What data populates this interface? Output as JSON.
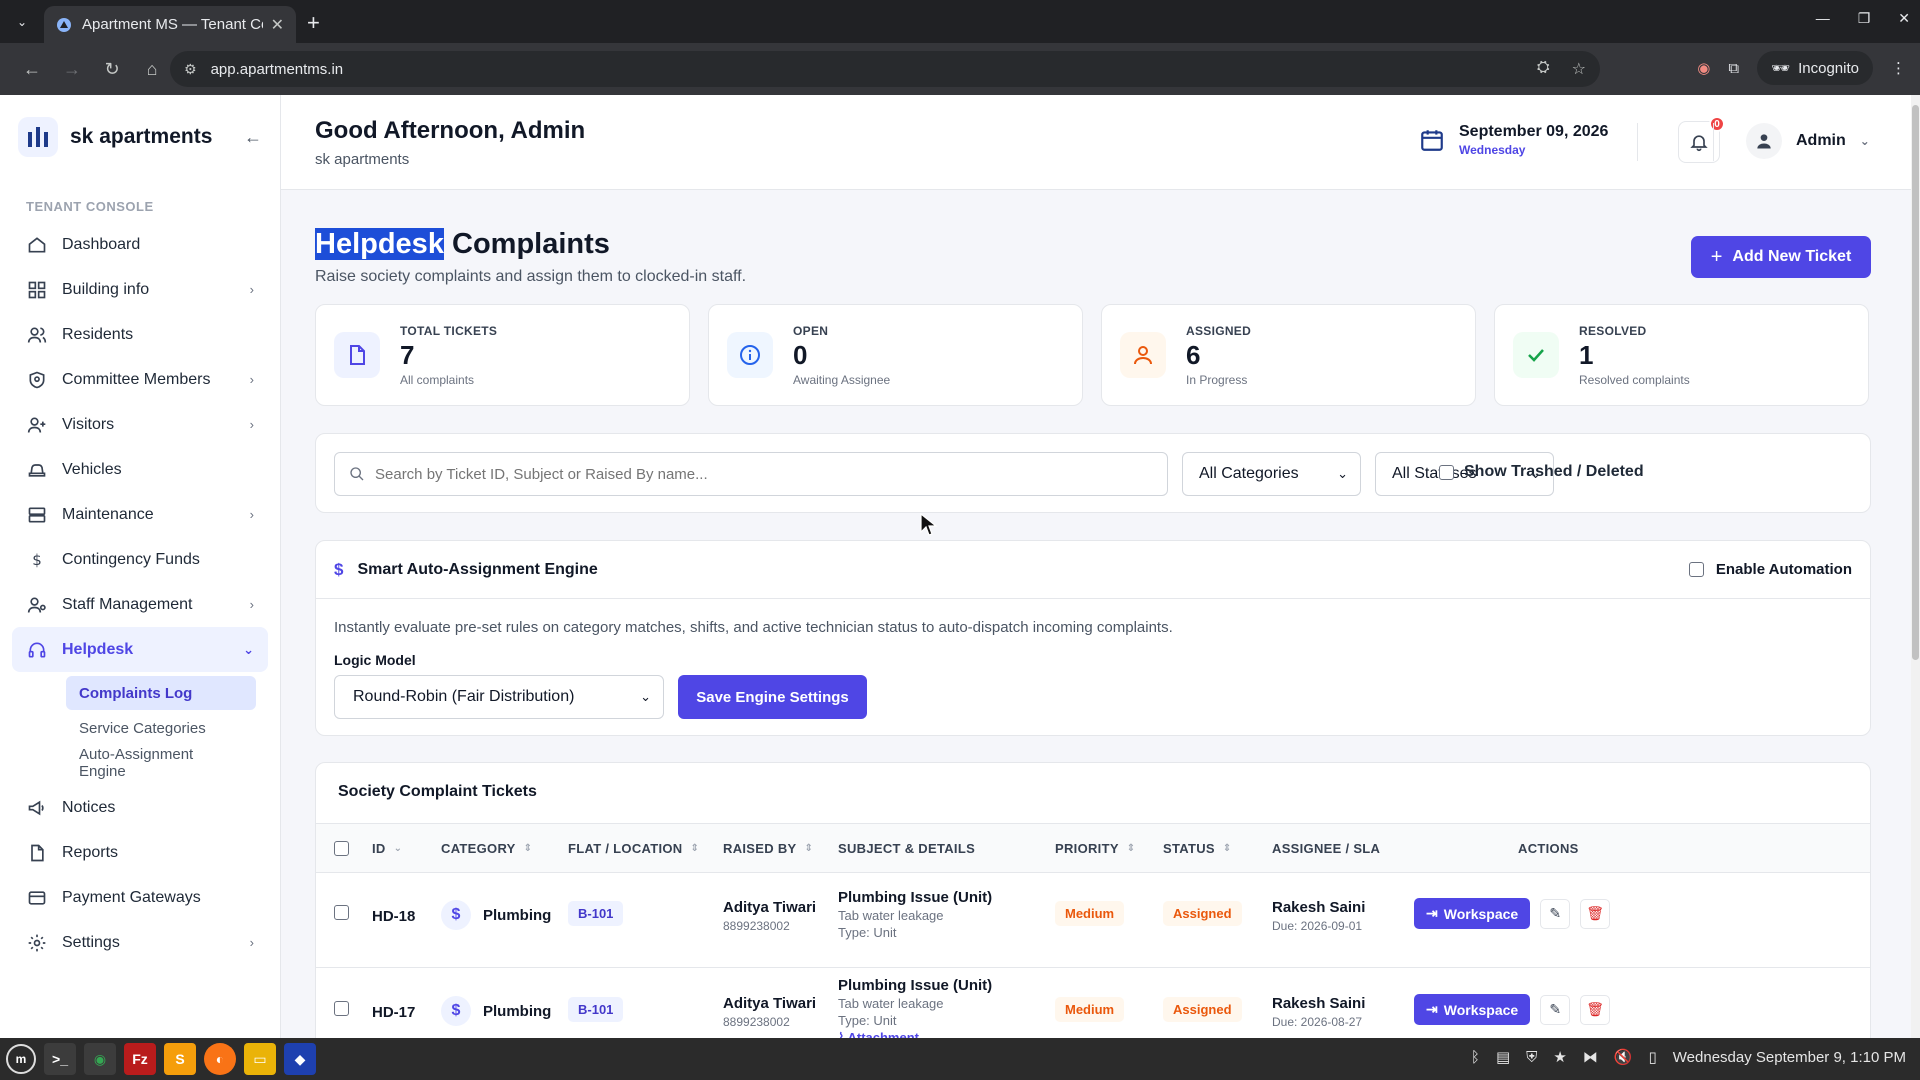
{
  "browser": {
    "tab_title": "Apartment MS — Tenant Co",
    "url": "app.apartmentms.in",
    "incognito_label": "Incognito"
  },
  "sidebar": {
    "brand": "sk apartments",
    "section_label": "TENANT CONSOLE",
    "items": [
      {
        "label": "Dashboard",
        "icon": "home-icon",
        "chevron": false
      },
      {
        "label": "Building info",
        "icon": "grid-icon",
        "chevron": true
      },
      {
        "label": "Residents",
        "icon": "users-icon",
        "chevron": false
      },
      {
        "label": "Committee Members",
        "icon": "shield-icon",
        "chevron": true
      },
      {
        "label": "Visitors",
        "icon": "user-plus-icon",
        "chevron": true
      },
      {
        "label": "Vehicles",
        "icon": "car-icon",
        "chevron": false
      },
      {
        "label": "Maintenance",
        "icon": "server-icon",
        "chevron": true
      },
      {
        "label": "Contingency Funds",
        "icon": "dollar-icon",
        "chevron": false
      },
      {
        "label": "Staff Management",
        "icon": "user-cog-icon",
        "chevron": true
      },
      {
        "label": "Helpdesk",
        "icon": "headphones-icon",
        "chevron": true,
        "active": true
      },
      {
        "label": "Notices",
        "icon": "megaphone-icon",
        "chevron": false
      },
      {
        "label": "Reports",
        "icon": "file-icon",
        "chevron": false
      },
      {
        "label": "Payment Gateways",
        "icon": "card-icon",
        "chevron": false
      },
      {
        "label": "Settings",
        "icon": "gear-icon",
        "chevron": true
      }
    ],
    "sub_items": [
      "Complaints Log",
      "Service Categories",
      "Auto-Assignment Engine"
    ]
  },
  "topbar": {
    "greeting": "Good Afternoon, Admin",
    "subtitle": "sk apartments",
    "date": "September 09, 2026",
    "day": "Wednesday",
    "notif_count": "0",
    "user": "Admin"
  },
  "page": {
    "title_highlight": "Helpdesk",
    "title_rest": " Complaints",
    "subtitle": "Raise society complaints and assign them to clocked-in staff.",
    "add_button": "Add New Ticket"
  },
  "stats": [
    {
      "label": "TOTAL TICKETS",
      "value": "7",
      "desc": "All complaints",
      "color": "#4f46e5",
      "bg": "#eef2ff"
    },
    {
      "label": "OPEN",
      "value": "0",
      "desc": "Awaiting Assignee",
      "color": "#2563eb",
      "bg": "#eff6ff"
    },
    {
      "label": "ASSIGNED",
      "value": "6",
      "desc": "In Progress",
      "color": "#ea580c",
      "bg": "#fff7ed"
    },
    {
      "label": "RESOLVED",
      "value": "1",
      "desc": "Resolved complaints",
      "color": "#16a34a",
      "bg": "#f0fdf4"
    }
  ],
  "filters": {
    "search_placeholder": "Search by Ticket ID, Subject or Raised By name...",
    "category": "All Categories",
    "status": "All Statuses",
    "trash_label": "Show Trashed / Deleted"
  },
  "engine": {
    "title": "Smart Auto-Assignment Engine",
    "automation_label": "Enable Automation",
    "description": "Instantly evaluate pre-set rules on category matches, shifts, and active technician status to auto-dispatch incoming complaints.",
    "logic_label": "Logic Model",
    "logic_value": "Round-Robin (Fair Distribution)",
    "save_button": "Save Engine Settings"
  },
  "tickets": {
    "title": "Society Complaint Tickets",
    "columns": [
      "ID",
      "CATEGORY",
      "FLAT / LOCATION",
      "RAISED BY",
      "SUBJECT & DETAILS",
      "PRIORITY",
      "STATUS",
      "ASSIGNEE / SLA",
      "ACTIONS"
    ],
    "rows": [
      {
        "id": "HD-18",
        "category": "Plumbing",
        "flat": "B-101",
        "raised_by": "Aditya Tiwari",
        "phone": "8899238002",
        "subject": "Plumbing Issue (Unit)",
        "detail": "Tab water leakage",
        "type": "Type: Unit",
        "attachment": "",
        "priority": "Medium",
        "status": "Assigned",
        "assignee": "Rakesh Saini",
        "due": "Due: 2026-09-01",
        "action": "Workspace"
      },
      {
        "id": "HD-17",
        "category": "Plumbing",
        "flat": "B-101",
        "raised_by": "Aditya Tiwari",
        "phone": "8899238002",
        "subject": "Plumbing Issue (Unit)",
        "detail": "Tab water leakage",
        "type": "Type: Unit",
        "attachment": "Attachment",
        "priority": "Medium",
        "status": "Assigned",
        "assignee": "Rakesh Saini",
        "due": "Due: 2026-08-27",
        "action": "Workspace"
      }
    ]
  },
  "taskbar": {
    "clock": "Wednesday September 9, 1:10 PM"
  }
}
